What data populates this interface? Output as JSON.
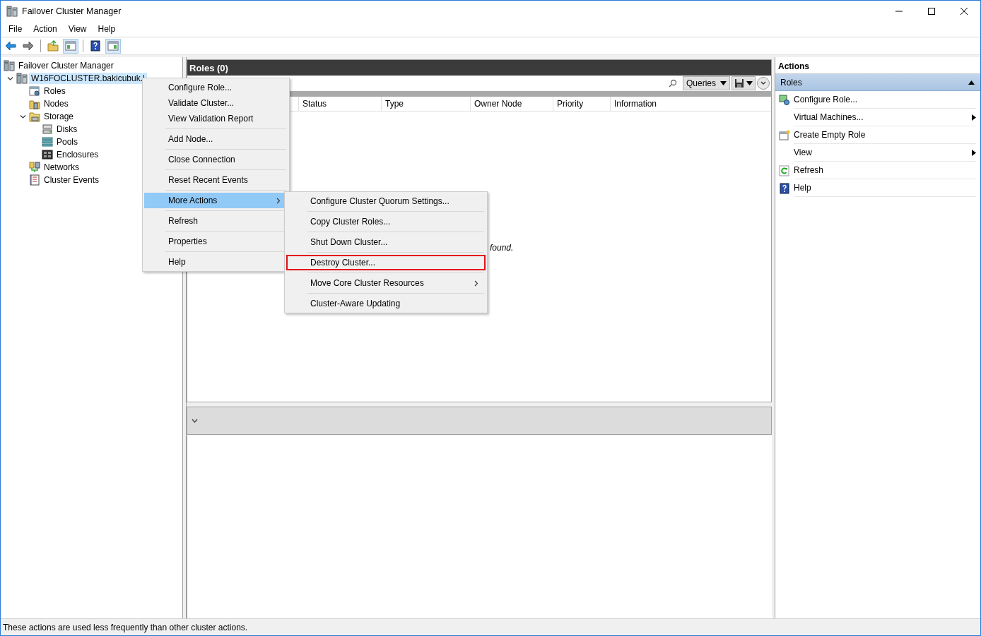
{
  "window": {
    "title": "Failover Cluster Manager"
  },
  "menu_bar": [
    {
      "label": "File"
    },
    {
      "label": "Action"
    },
    {
      "label": "View"
    },
    {
      "label": "Help"
    }
  ],
  "toolbar": [
    {
      "kind": "back",
      "pressed": false
    },
    {
      "kind": "forward",
      "pressed": false
    },
    {
      "kind": "up",
      "pressed": false
    },
    {
      "kind": "tree",
      "pressed": true
    },
    {
      "kind": "help",
      "pressed": false
    },
    {
      "kind": "pane",
      "pressed": true
    }
  ],
  "tree": [
    {
      "label": "Failover Cluster Manager",
      "selected": false,
      "kind": "manager",
      "children": [
        {
          "label": "W16FOCLUSTER.bakicubuk.l",
          "selected": true,
          "expanded": true,
          "kind": "cluster",
          "children": [
            {
              "label": "Roles",
              "selected": false,
              "kind": "roles"
            },
            {
              "label": "Nodes",
              "selected": false,
              "kind": "nodes"
            },
            {
              "label": "Storage",
              "selected": false,
              "expanded": true,
              "kind": "storage",
              "children": [
                {
                  "label": "Disks",
                  "selected": false,
                  "kind": "disks"
                },
                {
                  "label": "Pools",
                  "selected": false,
                  "kind": "pools"
                },
                {
                  "label": "Enclosures",
                  "selected": false,
                  "kind": "enclosures"
                }
              ]
            },
            {
              "label": "Networks",
              "selected": false,
              "kind": "networks"
            },
            {
              "label": "Cluster Events",
              "selected": false,
              "kind": "events"
            }
          ]
        }
      ]
    }
  ],
  "center": {
    "title": "Roles (0)",
    "queries_button": "Queries",
    "columns": [
      "Status",
      "Type",
      "Owner Node",
      "Priority",
      "Information"
    ],
    "empty_message": "found."
  },
  "actions": {
    "title": "Actions",
    "section": {
      "title": "Roles",
      "expanded": true
    },
    "items": [
      {
        "label": "Configure Role...",
        "kind": "configure"
      },
      {
        "label": "Virtual Machines...",
        "kind": "submenu"
      },
      {
        "label": "Create Empty Role",
        "kind": "create"
      },
      {
        "label": "View",
        "kind": "submenu"
      },
      {
        "label": "Refresh",
        "kind": "refresh"
      },
      {
        "label": "Help",
        "kind": "help"
      }
    ]
  },
  "context_menu": {
    "groups": [
      {
        "items": [
          {
            "label": "Configure Role...",
            "selected": false,
            "submenu": false
          },
          {
            "label": "Validate Cluster...",
            "selected": false,
            "submenu": false
          },
          {
            "label": "View Validation Report",
            "selected": false,
            "submenu": false
          }
        ]
      },
      {
        "items": [
          {
            "label": "Add Node...",
            "selected": false,
            "submenu": false
          }
        ]
      },
      {
        "items": [
          {
            "label": "Close Connection",
            "selected": false,
            "submenu": false
          }
        ]
      },
      {
        "items": [
          {
            "label": "Reset Recent Events",
            "selected": false,
            "submenu": false
          }
        ]
      },
      {
        "items": [
          {
            "label": "More Actions",
            "selected": true,
            "submenu": true
          }
        ]
      },
      {
        "items": [
          {
            "label": "Refresh",
            "selected": false,
            "submenu": false
          }
        ]
      },
      {
        "items": [
          {
            "label": "Properties",
            "selected": false,
            "submenu": false
          }
        ]
      },
      {
        "items": [
          {
            "label": "Help",
            "selected": false,
            "submenu": false
          }
        ]
      }
    ]
  },
  "submenu": {
    "items": [
      {
        "label": "Configure Cluster Quorum Settings...",
        "highlighted": false,
        "submenu": false
      },
      {
        "label": "Copy Cluster Roles...",
        "highlighted": false,
        "submenu": false
      },
      {
        "label": "Shut Down Cluster...",
        "highlighted": false,
        "submenu": false
      },
      {
        "label": "Destroy Cluster...",
        "highlighted": true,
        "submenu": false
      },
      {
        "label": "Move Core Cluster Resources",
        "highlighted": false,
        "submenu": true
      },
      {
        "label": "Cluster-Aware Updating",
        "highlighted": false,
        "submenu": false
      }
    ]
  },
  "status_bar": {
    "text": "These actions are used less frequently than other cluster actions."
  }
}
